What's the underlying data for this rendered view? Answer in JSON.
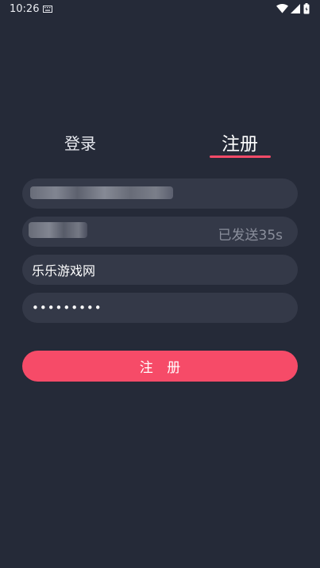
{
  "status_bar": {
    "time": "10:26",
    "icons": [
      "keyboard-icon",
      "wifi-icon",
      "sim-icon",
      "battery-icon"
    ]
  },
  "tabs": [
    {
      "label": "登录",
      "active": false
    },
    {
      "label": "注册",
      "active": true
    }
  ],
  "form": {
    "phone": {
      "value": "",
      "redacted": true
    },
    "verification_code": {
      "value": "",
      "redacted": true,
      "countdown_label": "已发送35s"
    },
    "username": {
      "value": "乐乐游戏网"
    },
    "password": {
      "value": "•••••••••"
    }
  },
  "submit_label": "注 册",
  "colors": {
    "background": "#252a38",
    "field": "#343948",
    "accent": "#f64b68",
    "muted_text": "#8a8e9b"
  }
}
